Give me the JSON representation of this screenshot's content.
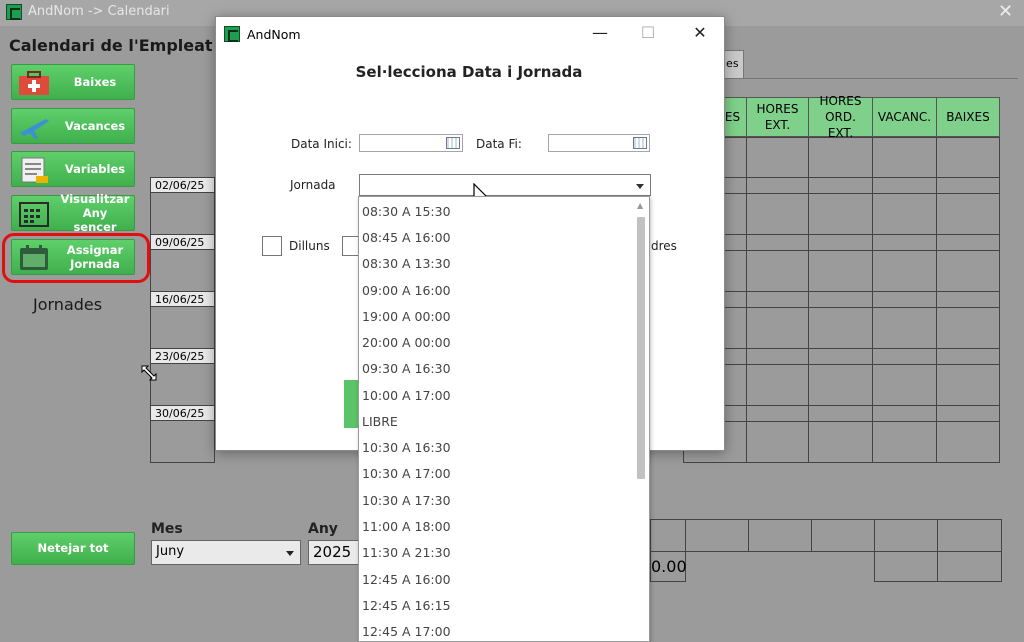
{
  "window": {
    "title": "AndNom -> Calendari",
    "close_glyph": "✕"
  },
  "page_heading": "Calendari de l'Empleat : A",
  "sidebar": {
    "buttons": [
      {
        "label": "Baixes",
        "icon": "medical-kit-icon"
      },
      {
        "label": "Vacances",
        "icon": "airplane-icon"
      },
      {
        "label": "Variables",
        "icon": "clipboard-icon"
      },
      {
        "label": "Visualitzar Any sencer",
        "icon": "calendar-grid-icon"
      },
      {
        "label": "Assignar Jornada",
        "icon": "calendar-icon"
      }
    ],
    "jornades_label": "Jornades",
    "clear_button": "Netejar tot"
  },
  "dates": [
    "02/06/25",
    "09/06/25",
    "16/06/25",
    "23/06/25",
    "30/06/25"
  ],
  "tab_partial": "les",
  "grid_headers": [
    "HORES EXT.",
    "HORES ORD. EXT.",
    "VACANC.",
    "BAIXES"
  ],
  "grid_header_partial": "ES",
  "month": {
    "label": "Mes",
    "value": "Juny"
  },
  "year": {
    "label": "Any",
    "value": "2025"
  },
  "total_partial": "0.00",
  "dialog": {
    "title": "AndNom",
    "heading": "Sel·lecciona Data i Jornada",
    "data_inici_label": "Data Inici:",
    "data_fi_label": "Data Fi:",
    "jornada_label": "Jornada",
    "dilluns_label": "Dilluns",
    "divendres_partial": "dres",
    "minimize": "—",
    "maximize": "☐",
    "close": "✕"
  },
  "jornada_options": [
    "08:30 A 15:30",
    "08:45 A 16:00",
    "08:30 A 13:30",
    "09:00 A 16:00",
    "19:00 A 00:00",
    "20:00 A 00:00",
    "09:30 A 16:30",
    "10:00 A 17:00",
    "LIBRE",
    "10:30 A 16:30",
    "10:30 A 17:00",
    "10:30 A 17:30",
    "11:00 A 18:00",
    "11:30 A 21:30",
    "12:45 A 16:00",
    "12:45 A 16:15",
    "12:45 A 17:00"
  ],
  "colors": {
    "accent_green": "#4cbf5a",
    "highlight_red": "#e01010",
    "header_green": "#7fd08a"
  }
}
